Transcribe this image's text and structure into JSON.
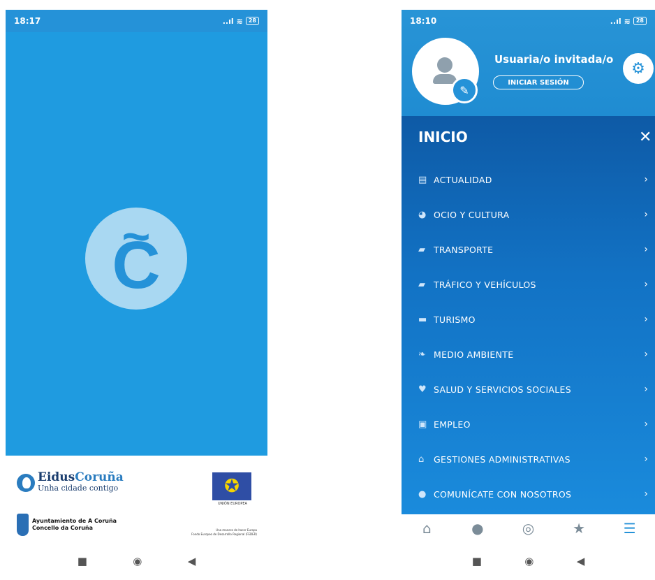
{
  "left": {
    "status": {
      "time": "18:17",
      "signal": "..ıl",
      "wifi": "≋",
      "battery": "28"
    },
    "logo": {
      "tilde": "~",
      "letter": "C"
    },
    "sponsors": {
      "eidus_name_a": "Eidus",
      "eidus_name_b": "Coruña",
      "eidus_tagline": "Unha cidade contigo",
      "eu_caption": "UNIÓN EUROPEA",
      "ayto_line1": "Ayuntamiento de A Coruña",
      "ayto_line2": "Concello da Coruña",
      "eu_fund_line1": "Una manera de hacer Europa",
      "eu_fund_line2": "Fondo Europeo de Desarrollo Regional (FEDER)"
    }
  },
  "right": {
    "status": {
      "time": "18:10",
      "signal": "..ıl",
      "wifi": "≋",
      "battery": "28"
    },
    "profile": {
      "user_name": "Usuaria/o invitada/o",
      "login_label": "INICIAR SESIÓN"
    },
    "menu": {
      "title": "INICIO",
      "close": "✕",
      "items": [
        {
          "label": "ACTUALIDAD",
          "icon": "▤"
        },
        {
          "label": "OCIO Y CULTURA",
          "icon": "◕"
        },
        {
          "label": "TRANSPORTE",
          "icon": "▰"
        },
        {
          "label": "TRÁFICO Y VEHÍCULOS",
          "icon": "▰"
        },
        {
          "label": "TURISMO",
          "icon": "▬"
        },
        {
          "label": "MEDIO AMBIENTE",
          "icon": "❧"
        },
        {
          "label": "SALUD Y SERVICIOS SOCIALES",
          "icon": "♥"
        },
        {
          "label": "EMPLEO",
          "icon": "▣"
        },
        {
          "label": "GESTIONES ADMINISTRATIVAS",
          "icon": "⌂"
        },
        {
          "label": "COMUNÍCATE CON NOSOTROS",
          "icon": "●"
        }
      ],
      "chevron": "›"
    },
    "tabs": [
      {
        "name": "home",
        "glyph": "⌂"
      },
      {
        "name": "profile",
        "glyph": "●"
      },
      {
        "name": "explore",
        "glyph": "◎"
      },
      {
        "name": "favorites",
        "glyph": "★"
      },
      {
        "name": "menu",
        "glyph": "☰"
      }
    ]
  },
  "system_nav": {
    "recents": "■",
    "home": "◉",
    "back": "◀"
  },
  "colors": {
    "primary": "#1f9be0",
    "menu_dark": "#0e5aa6",
    "logo_light": "#a9d8f2"
  }
}
